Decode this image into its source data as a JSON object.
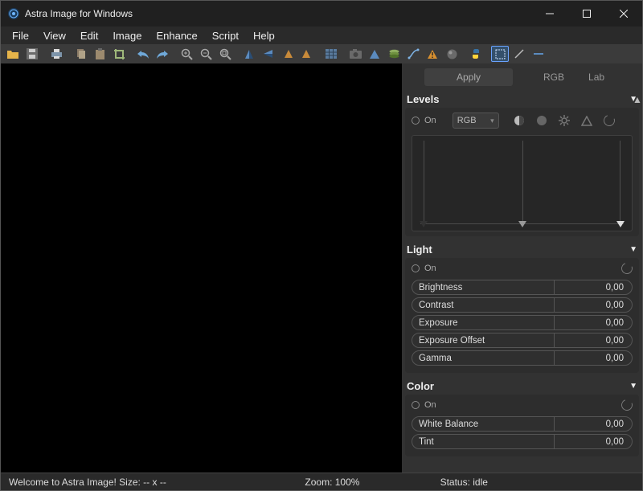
{
  "title": "Astra Image for Windows",
  "menus": [
    "File",
    "View",
    "Edit",
    "Image",
    "Enhance",
    "Script",
    "Help"
  ],
  "toolbar_icons": [
    "open-icon",
    "save-icon",
    "sep",
    "print-icon",
    "sep",
    "copy-icon",
    "paste-icon",
    "crop-icon",
    "sep",
    "undo-icon",
    "redo-icon",
    "sep",
    "zoom-in-icon",
    "zoom-out-icon",
    "zoom-fit-icon",
    "sep",
    "flip-h-icon",
    "flip-v-icon",
    "rotate-l-icon",
    "rotate-r-icon",
    "sep",
    "grid-icon",
    "sep",
    "camera-icon",
    "pyramid-icon",
    "layers-icon",
    "curve-icon",
    "warning-icon",
    "sphere-icon",
    "sep",
    "python-icon",
    "sep",
    "marquee-icon",
    "line-icon",
    "dash-icon"
  ],
  "tabs": {
    "apply": "Apply",
    "rgb": "RGB",
    "lab": "Lab"
  },
  "levels": {
    "title": "Levels",
    "on": "On",
    "channel": "RGB"
  },
  "light": {
    "title": "Light",
    "on": "On",
    "params": [
      {
        "name": "Brightness",
        "value": "0,00"
      },
      {
        "name": "Contrast",
        "value": "0,00"
      },
      {
        "name": "Exposure",
        "value": "0,00"
      },
      {
        "name": "Exposure Offset",
        "value": "0,00"
      },
      {
        "name": "Gamma",
        "value": "0,00"
      }
    ]
  },
  "color": {
    "title": "Color",
    "on": "On",
    "params": [
      {
        "name": "White Balance",
        "value": "0,00"
      },
      {
        "name": "Tint",
        "value": "0,00"
      }
    ]
  },
  "status": {
    "left": "Welcome to Astra Image! Size: -- x --",
    "center": "Zoom: 100%",
    "right": "Status: idle"
  },
  "colors": {
    "accent": "#6aa3ff"
  }
}
